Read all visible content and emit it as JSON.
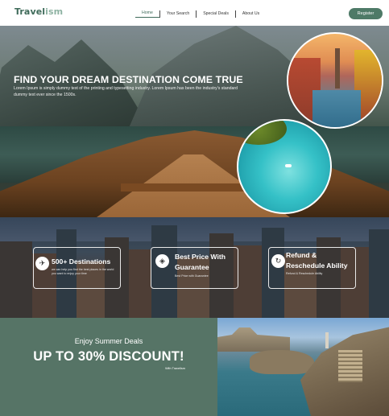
{
  "nav": {
    "logo_part1": "Travel",
    "logo_part2": "ism",
    "menu": [
      "Home",
      "Your Search",
      "Special Deals",
      "About Us"
    ],
    "active_index": 0,
    "register_label": "Register"
  },
  "hero": {
    "title": "FIND YOUR DREAM DESTINATION COME TRUE",
    "description": "Lorem Ipsum is simply dummy text of the printing and typesetting industry. Lorem Ipsum has been the industry's standard dummy text ever since the 1500s."
  },
  "features": [
    {
      "icon": "paper-plane-icon",
      "glyph": "✈",
      "title": "500+ Destinations",
      "subtitle": "we can help you find the best places in the world you want to enjoy your time"
    },
    {
      "icon": "price-tag-icon",
      "glyph": "◈",
      "title_line1": "Best Price With",
      "title_line2": "Guarantee",
      "subtitle": "Best Price with Guarantee"
    },
    {
      "icon": "calendar-refresh-icon",
      "glyph": "↻",
      "title_line1": "Refund &",
      "title_line2": "Reschedule Ability",
      "subtitle": "Refund & Reschedule Ability"
    }
  ],
  "promo": {
    "subtitle": "Enjoy Summer Deals",
    "title": "UP TO 30% DISCOUNT!",
    "note": "With Travelism"
  },
  "colors": {
    "brand": "#3f6b5a",
    "brand_light": "#8fb3a3",
    "button": "#4e7a67",
    "promo_bg": "#567466"
  }
}
